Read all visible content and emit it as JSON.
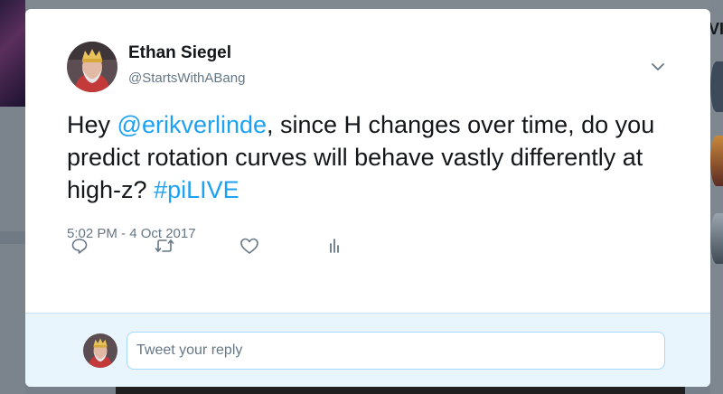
{
  "tweet": {
    "author_name": "Ethan Siegel",
    "author_handle": "@StartsWithABang",
    "text_parts": {
      "p1": "Hey ",
      "mention": "@erikverlinde",
      "p2": ", since H changes over time, do you predict rotation curves will behave vastly differently at high-z? ",
      "hashtag": "#piLIVE"
    },
    "timestamp": "5:02 PM - 4 Oct 2017"
  },
  "actions": {
    "reply_icon": "reply-icon",
    "retweet_icon": "retweet-icon",
    "like_icon": "like-icon",
    "analytics_icon": "analytics-icon",
    "more_icon": "chevron-down-icon"
  },
  "reply": {
    "placeholder": "Tweet your reply"
  },
  "background": {
    "right_heading_fragment": "VI"
  },
  "colors": {
    "link": "#1da1f2",
    "text": "#14171a",
    "secondary": "#657786",
    "icon": "#657786",
    "reply_bar": "#e8f5fd"
  }
}
